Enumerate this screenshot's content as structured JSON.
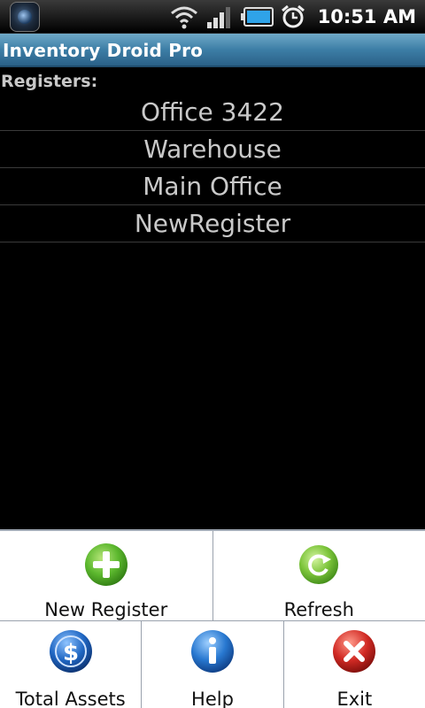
{
  "status_bar": {
    "time": "10:51 AM",
    "icons": [
      "app-notification-icon",
      "wifi-icon",
      "signal-icon",
      "battery-icon",
      "alarm-icon"
    ]
  },
  "app": {
    "title": "Inventory Droid Pro"
  },
  "content": {
    "registers_label": "Registers:",
    "registers": [
      {
        "label": "Office 3422"
      },
      {
        "label": "Warehouse"
      },
      {
        "label": "Main Office"
      },
      {
        "label": "NewRegister"
      }
    ]
  },
  "menu": {
    "new_register": {
      "label": "New Register",
      "icon": "plus-icon"
    },
    "refresh": {
      "label": "Refresh",
      "icon": "refresh-icon"
    },
    "total_assets": {
      "label": "Total Assets",
      "icon": "dollar-icon"
    },
    "help": {
      "label": "Help",
      "icon": "info-icon"
    },
    "exit": {
      "label": "Exit",
      "icon": "close-icon"
    }
  },
  "colors": {
    "title_bar": "#3d7ea6",
    "background": "#000000",
    "menu_background": "#ffffff",
    "plus_green": "#5cb82e",
    "refresh_green": "#7cc43a",
    "dollar_blue": "#1f66c2",
    "info_blue": "#2878d0",
    "exit_red": "#d12a24"
  }
}
